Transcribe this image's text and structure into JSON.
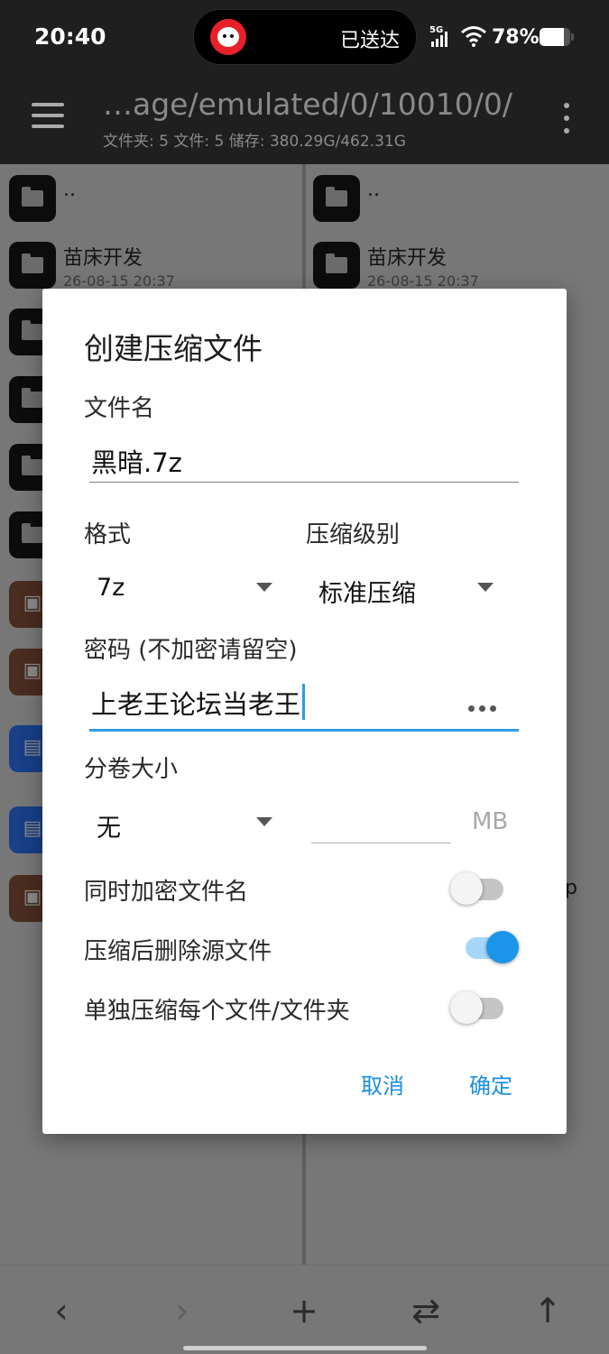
{
  "status_bar": {
    "time": "20:40",
    "island_text": "已送达",
    "network": "5G",
    "battery_percent": "78%",
    "battery_level": 0.78
  },
  "app_bar": {
    "path": "…age/emulated/0/10010/0/",
    "stats": "文件夹: 5   文件: 5   储存: 380.29G/462.31G"
  },
  "left_pane": {
    "rows": [
      {
        "name": "..",
        "date": ""
      },
      {
        "name": "苗床开发",
        "date": "26-08-15 20:37"
      }
    ]
  },
  "right_pane": {
    "rows": [
      {
        "name": "..",
        "date": ""
      },
      {
        "name": "苗床开发",
        "date": "26-08-15 20:37"
      }
    ],
    "stray_char": "p"
  },
  "dialog": {
    "title": "创建压缩文件",
    "filename_label": "文件名",
    "filename_value": "黑暗.7z",
    "format_label": "格式",
    "format_value": "7z",
    "level_label": "压缩级别",
    "level_value": "标准压缩",
    "password_label": "密码 (不加密请留空)",
    "password_value": "上老王论坛当老王",
    "split_label": "分卷大小",
    "split_value": "无",
    "split_size_value": "",
    "split_unit": "MB",
    "options": [
      {
        "label": "同时加密文件名",
        "checked": false
      },
      {
        "label": "压缩后删除源文件",
        "checked": true
      },
      {
        "label": "单独压缩每个文件/文件夹",
        "checked": false
      }
    ],
    "cancel_label": "取消",
    "ok_label": "确定"
  },
  "bottom_bar": {
    "back_icon": "‹",
    "forward_icon": "›",
    "add_icon": "+",
    "swap_icon": "⇄",
    "up_icon": "↑"
  },
  "colors": {
    "accent": "#1a95ea",
    "dialog_bg": "#ffffff",
    "toolbar_bg": "#1f1f1f"
  }
}
